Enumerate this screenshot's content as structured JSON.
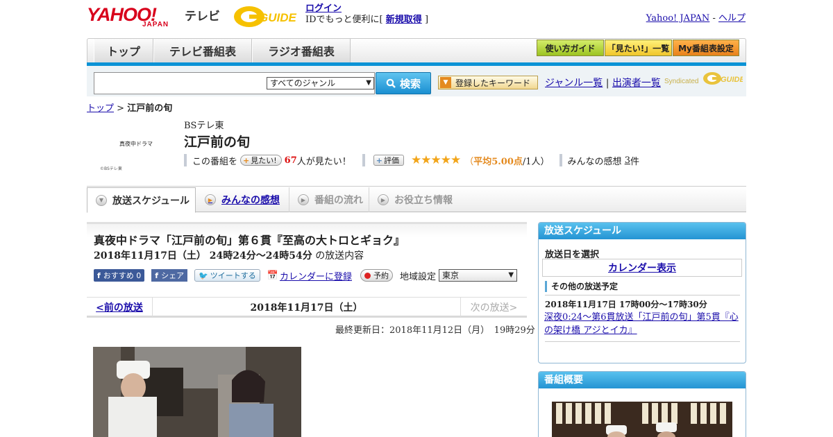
{
  "header": {
    "brand_yahoo": "YAHOO!",
    "brand_japan": "JAPAN",
    "brand_service": "テレビ",
    "gguide_logo": "GUIDE",
    "login_link": "ログイン",
    "login_text_prefix": "IDでもっと便利に[",
    "register_link": "新規取得",
    "login_text_suffix": "]",
    "yahoo_japan_link": "Yahoo! JAPAN",
    "separator": "-",
    "help_link": "ヘルプ"
  },
  "nav": {
    "tabs": [
      "トップ",
      "テレビ番組表",
      "ラジオ番組表"
    ],
    "buttons": [
      "使い方ガイド",
      "「見たい!」一覧",
      "My番組表設定"
    ]
  },
  "search": {
    "genre_selected": "すべてのジャンル",
    "button_label": "検索",
    "keyword_button": "登録したキーワード",
    "genre_list_link": "ジャンル一覧",
    "divider": "|",
    "performer_link": "出演者一覧",
    "syndicated": "Syndicated"
  },
  "breadcrumb": {
    "top": "トップ",
    "sep": ">",
    "current": "江戸前の旬"
  },
  "program": {
    "thumb_title": "真夜中ドラマ",
    "thumb_credit": "©BSテレ東",
    "channel": "BSテレ東",
    "title": "江戸前の旬",
    "want_prefix": "この番組を",
    "want_button": "見たい!",
    "want_count": "67",
    "want_suffix": "人が見たい！",
    "rate_button": "評価",
    "stars": "★★★★★",
    "avg_open": "（",
    "avg_label": "平均5.00点",
    "avg_people": "/1人）",
    "review_label": "みんなの感想",
    "review_count": "3",
    "review_suffix": "件"
  },
  "tabs": [
    {
      "label": "放送スケジュール",
      "state": "active"
    },
    {
      "label": "みんなの感想",
      "state": "link"
    },
    {
      "label": "番組の流れ",
      "state": "disabled"
    },
    {
      "label": "お役立ち情報",
      "state": "disabled"
    }
  ],
  "episode": {
    "title": "真夜中ドラマ「江戸前の旬」第６貫『至高の大トロとギョク』",
    "date_bold": "2018年11月17日（土）  24時24分～24時54分",
    "date_suffix": "の放送内容",
    "fb_recommend": "おすすめ",
    "fb_count": "0",
    "fb_share": "シェア",
    "tweet": "ツイートする",
    "calendar_link": "カレンダーに登録",
    "reserve": "予約",
    "region_label": "地域設定",
    "region_selected": "東京"
  },
  "pager": {
    "prev": "<前の放送",
    "date": "2018年11月17日（土）",
    "next": "次の放送>"
  },
  "updated": "最終更新日：2018年11月12日（月）　19時29分",
  "sidebar": {
    "schedule_title": "放送スケジュール",
    "select_date": "放送日を選択",
    "calendar_link": "カレンダー表示",
    "other_label": "その他の放送予定",
    "other_date": "2018年11月17日  17時00分～17時30分",
    "other_link": "深夜0:24～第6貫放送「江戸前の旬」第5貫『心の架け橋 アジとイカ』",
    "overview_title": "番組概要"
  },
  "colors": {
    "accent_blue": "#0b93d6",
    "yahoo_red": "#d8001b",
    "star_orange": "#f2a51a"
  }
}
